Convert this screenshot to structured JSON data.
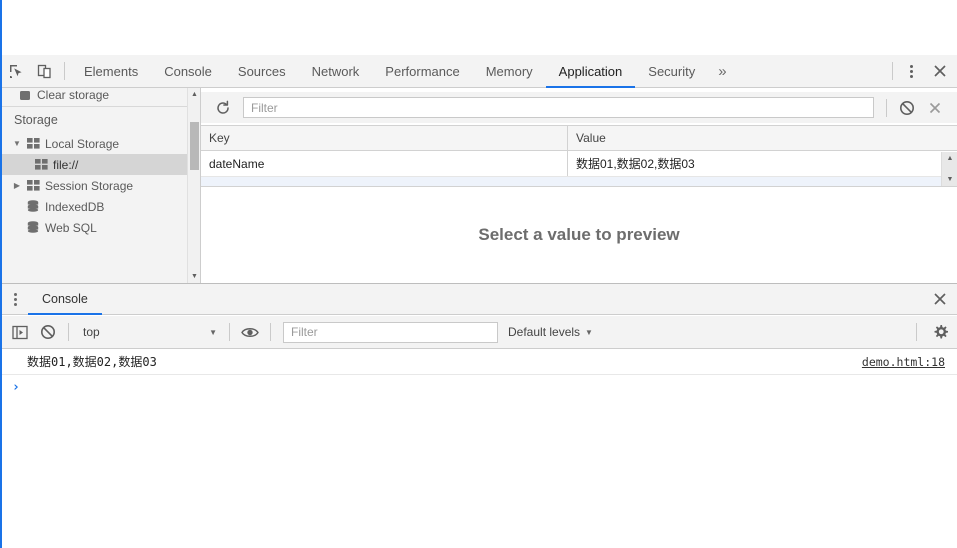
{
  "theme": {
    "accent": "#1a73e8",
    "toolbar_bg": "#f3f3f3",
    "panel_bg": "#ffffff",
    "selected_row_bg": "#d5d5d5"
  },
  "main_toolbar": {
    "inspect_icon": "inspect-element-icon",
    "device_icon": "device-toolbar-icon",
    "tabs": [
      {
        "label": "Elements",
        "active": false
      },
      {
        "label": "Console",
        "active": false
      },
      {
        "label": "Sources",
        "active": false
      },
      {
        "label": "Network",
        "active": false
      },
      {
        "label": "Performance",
        "active": false
      },
      {
        "label": "Memory",
        "active": false
      },
      {
        "label": "Application",
        "active": true
      },
      {
        "label": "Security",
        "active": false
      }
    ],
    "more_tabs_label": "»",
    "menu_icon": "kebab-menu-icon",
    "close_icon": "close-icon"
  },
  "sidebar": {
    "clipped_top_item": {
      "label": "Clear storage",
      "icon": "clear-storage-icon"
    },
    "section_header": "Storage",
    "items": [
      {
        "label": "Local Storage",
        "icon": "storage-table-icon",
        "expanded": true,
        "selected": false,
        "indent": 0
      },
      {
        "label": "file://",
        "icon": "storage-table-icon",
        "expanded": null,
        "selected": true,
        "indent": 1
      },
      {
        "label": "Session Storage",
        "icon": "storage-table-icon",
        "expanded": false,
        "selected": false,
        "indent": 0
      },
      {
        "label": "IndexedDB",
        "icon": "database-icon",
        "expanded": null,
        "selected": false,
        "indent": 0
      },
      {
        "label": "Web SQL",
        "icon": "database-icon",
        "expanded": null,
        "selected": false,
        "indent": 0
      }
    ],
    "scrollbar": {
      "up_arrow": "scroll-up-arrow-icon",
      "down_arrow": "scroll-down-arrow-icon"
    }
  },
  "storage_panel": {
    "toolbar": {
      "refresh_icon": "refresh-icon",
      "filter_placeholder": "Filter",
      "filter_value": "",
      "clear_icon": "clear-all-icon",
      "delete_icon": "delete-selected-icon"
    },
    "table": {
      "columns": [
        "Key",
        "Value"
      ],
      "rows": [
        {
          "key": "dateName",
          "value": "数据01,数据02,数据03"
        }
      ]
    },
    "preview_placeholder": "Select a value to preview"
  },
  "drawer": {
    "menu_icon": "kebab-menu-icon",
    "tabs": [
      {
        "label": "Console",
        "active": true
      }
    ],
    "close_icon": "close-icon"
  },
  "console_toolbar": {
    "sidebar_toggle_icon": "console-sidebar-toggle-icon",
    "clear_icon": "clear-console-icon",
    "context_selected": "top",
    "context_caret": "▼",
    "eye_icon": "live-expression-icon",
    "filter_placeholder": "Filter",
    "filter_value": "",
    "levels_label": "Default levels",
    "levels_caret": "▼",
    "settings_icon": "gear-icon"
  },
  "console_output": {
    "messages": [
      {
        "text": "数据01,数据02,数据03",
        "source": "demo.html:18"
      }
    ],
    "prompt": "›"
  }
}
